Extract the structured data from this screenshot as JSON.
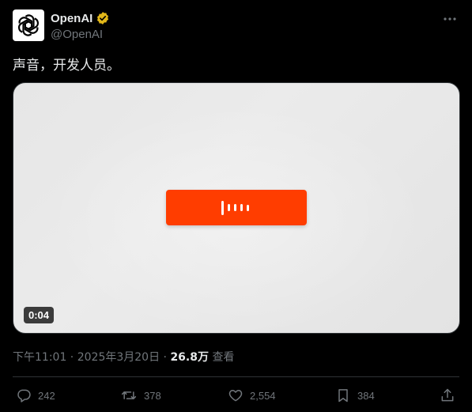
{
  "author": {
    "display_name": "OpenAI",
    "handle": "@OpenAI",
    "verified_icon": "verified-badge-icon",
    "verified_color": "#e2b719",
    "avatar_icon": "openai-logo-icon"
  },
  "tweet": {
    "text": "声音，开发人员。"
  },
  "media": {
    "duration": "0:04",
    "button_color": "#ff3d00",
    "button_icon": "audio-bars-icon"
  },
  "meta": {
    "time": "下午11:01",
    "separator": " · ",
    "date": "2025年3月20日",
    "views_count": "26.8万",
    "views_label": "查看"
  },
  "actions": {
    "reply_count": "242",
    "repost_count": "378",
    "like_count": "2,554",
    "bookmark_count": "384"
  },
  "colors": {
    "background": "#000000",
    "text": "#e7e9ea",
    "muted": "#71767b"
  }
}
